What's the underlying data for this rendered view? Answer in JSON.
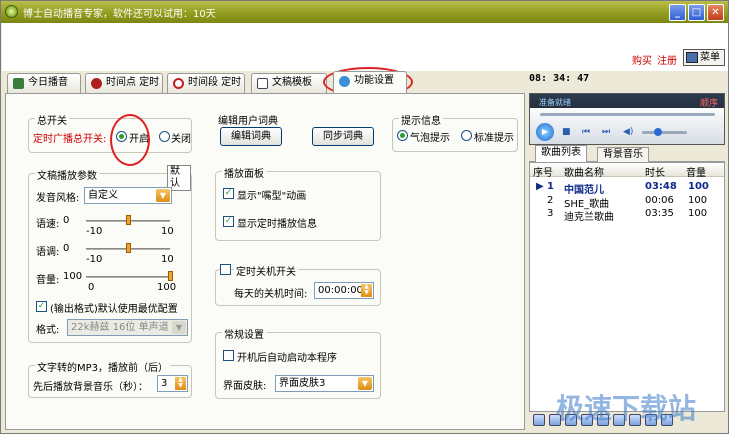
{
  "window": {
    "title": "博士自动播音专家，软件还可以试用：10天"
  },
  "header": {
    "buy_label": "购买",
    "register_label": "注册",
    "menu_label": "菜单"
  },
  "tabs": [
    {
      "label": "今日播音",
      "icon": "calendar-icon"
    },
    {
      "label": "时间点 定时",
      "icon": "alarm-clock-icon"
    },
    {
      "label": "时间段 定时",
      "icon": "clock-icon"
    },
    {
      "label": "文稿模板",
      "icon": "document-icon"
    },
    {
      "label": "功能设置",
      "icon": "gear-icon"
    }
  ],
  "master_switch": {
    "title": "总开关",
    "label": "定时广播总开关:",
    "on_label": "开启",
    "off_label": "关闭",
    "selected": "开启"
  },
  "speech_params": {
    "title": "文稿播放参数",
    "default_button": "默认",
    "voice_label": "发音风格:",
    "voice_value": "自定义",
    "speed_label": "语速:",
    "speed_value": "0",
    "speed_min": "-10",
    "speed_max": "10",
    "pitch_label": "语调:",
    "pitch_value": "0",
    "pitch_min": "-10",
    "pitch_max": "10",
    "volume_label": "音量:",
    "volume_value": "100",
    "volume_min": "0",
    "volume_max": "100",
    "output_checkbox_label": "(输出格式)默认使用最优配置",
    "output_checked": true,
    "format_label": "格式:",
    "format_value": "22k赫兹 16位 单声道"
  },
  "mp3_section": {
    "title": "文字转的MP3，播放前（后）",
    "bg_label": "先后播放背景音乐（秒）：",
    "bg_value": "3"
  },
  "dictionary": {
    "title": "编辑用户词典",
    "edit_button": "编辑词典",
    "sync_button": "同步词典"
  },
  "play_panel": {
    "title": "播放面板",
    "show_mouth_label": "显示\"嘴型\"动画",
    "show_mouth_checked": true,
    "show_timer_label": "显示定时播放信息",
    "show_timer_checked": true
  },
  "shutdown": {
    "checkbox_label": "定时关机开关",
    "checked": false,
    "time_label": "每天的关机时间:",
    "time_value": "00:00:00"
  },
  "general": {
    "title": "常规设置",
    "autostart_label": "开机后自动启动本程序",
    "autostart_checked": false,
    "skin_label": "界面皮肤:",
    "skin_value": "界面皮肤3"
  },
  "hint": {
    "title": "提示信息",
    "bubble_label": "气泡提示",
    "standard_label": "标准提示",
    "selected": "气泡提示"
  },
  "clock": {
    "time": "08: 34: 47"
  },
  "player": {
    "status": "准备就绪",
    "mode": "顺序",
    "tab_songs": "歌曲列表",
    "tab_bg": "背景音乐",
    "columns": [
      "序号",
      "歌曲名称",
      "时长",
      "音量"
    ],
    "rows": [
      {
        "no": "1",
        "name": "中国范儿",
        "duration": "03:48",
        "volume": "100",
        "current": true
      },
      {
        "no": "2",
        "name": "SHE_歌曲",
        "duration": "00:06",
        "volume": "100",
        "current": false
      },
      {
        "no": "3",
        "name": "迪克兰歌曲",
        "duration": "03:35",
        "volume": "100",
        "current": false
      }
    ]
  },
  "watermark": "极速下载站"
}
